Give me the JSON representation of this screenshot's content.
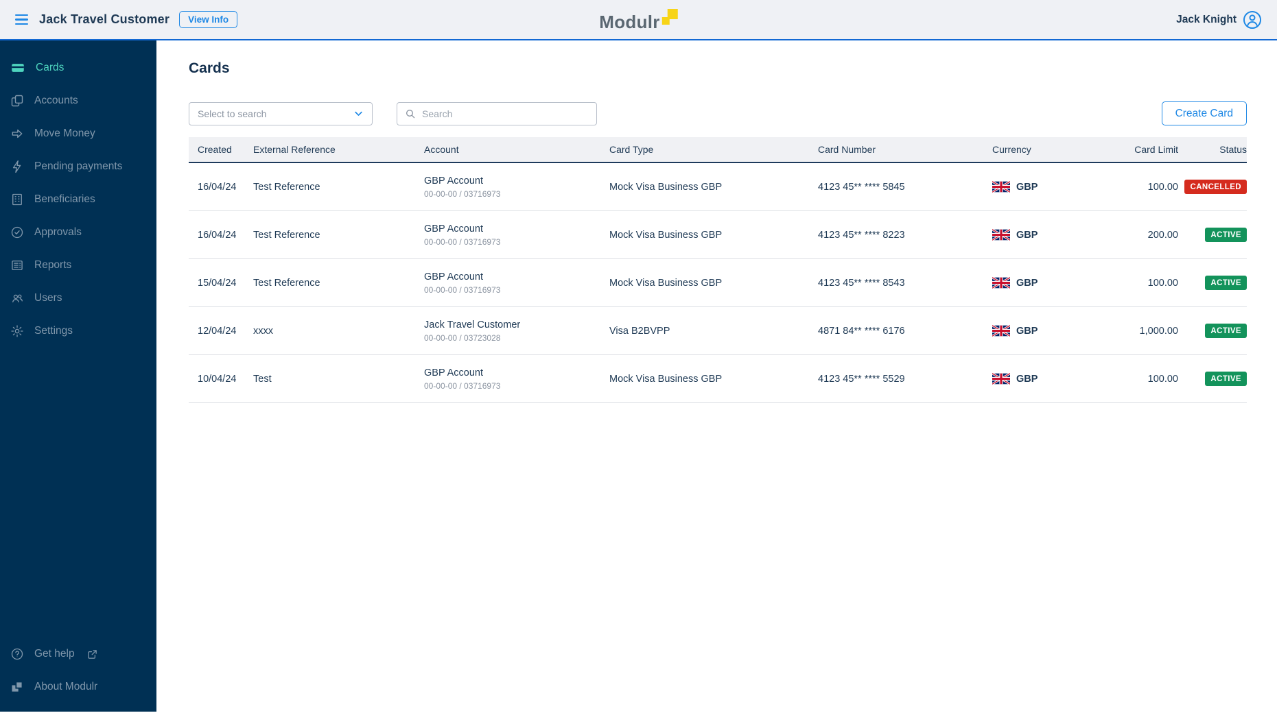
{
  "header": {
    "customer_name": "Jack Travel Customer",
    "view_info_label": "View Info",
    "logo_text": "Modulr",
    "user_name": "Jack Knight"
  },
  "sidebar": {
    "items": [
      {
        "label": "Cards",
        "icon": "card-icon",
        "active": true
      },
      {
        "label": "Accounts",
        "icon": "accounts-icon",
        "active": false
      },
      {
        "label": "Move Money",
        "icon": "arrow-right-icon",
        "active": false
      },
      {
        "label": "Pending payments",
        "icon": "lightning-icon",
        "active": false
      },
      {
        "label": "Beneficiaries",
        "icon": "building-grid-icon",
        "active": false
      },
      {
        "label": "Approvals",
        "icon": "check-circle-icon",
        "active": false
      },
      {
        "label": "Reports",
        "icon": "report-icon",
        "active": false
      },
      {
        "label": "Users",
        "icon": "users-icon",
        "active": false
      },
      {
        "label": "Settings",
        "icon": "gear-icon",
        "active": false
      }
    ],
    "footer_items": [
      {
        "label": "Get help",
        "icon": "help-icon",
        "external": true
      },
      {
        "label": "About Modulr",
        "icon": "modulr-squares-icon",
        "external": false
      }
    ]
  },
  "main": {
    "title": "Cards",
    "filter_placeholder": "Select to search",
    "search_placeholder": "Search",
    "create_button_label": "Create Card",
    "table": {
      "columns": [
        "Created",
        "External Reference",
        "Account",
        "Card Type",
        "Card Number",
        "Currency",
        "Card Limit",
        "Status"
      ],
      "rows": [
        {
          "created": "16/04/24",
          "external_reference": "Test Reference",
          "account_name": "GBP Account",
          "account_detail": "00-00-00 / 03716973",
          "card_type": "Mock Visa Business GBP",
          "card_number": "4123 45** **** 5845",
          "currency": "GBP",
          "card_limit": "100.00",
          "status": "CANCELLED"
        },
        {
          "created": "16/04/24",
          "external_reference": "Test Reference",
          "account_name": "GBP Account",
          "account_detail": "00-00-00 / 03716973",
          "card_type": "Mock Visa Business GBP",
          "card_number": "4123 45** **** 8223",
          "currency": "GBP",
          "card_limit": "200.00",
          "status": "ACTIVE"
        },
        {
          "created": "15/04/24",
          "external_reference": "Test Reference",
          "account_name": "GBP Account",
          "account_detail": "00-00-00 / 03716973",
          "card_type": "Mock Visa Business GBP",
          "card_number": "4123 45** **** 8543",
          "currency": "GBP",
          "card_limit": "100.00",
          "status": "ACTIVE"
        },
        {
          "created": "12/04/24",
          "external_reference": "xxxx",
          "account_name": "Jack Travel Customer",
          "account_detail": "00-00-00 / 03723028",
          "card_type": "Visa B2BVPP",
          "card_number": "4871 84** **** 6176",
          "currency": "GBP",
          "card_limit": "1,000.00",
          "status": "ACTIVE"
        },
        {
          "created": "10/04/24",
          "external_reference": "Test",
          "account_name": "GBP Account",
          "account_detail": "00-00-00 / 03716973",
          "card_type": "Mock Visa Business GBP",
          "card_number": "4123 45** **** 5529",
          "currency": "GBP",
          "card_limit": "100.00",
          "status": "ACTIVE"
        }
      ]
    }
  },
  "colors": {
    "accent_blue": "#1e88e5",
    "header_border_blue": "#1268d3",
    "sidebar_navy": "#003054",
    "active_teal": "#4ed4be",
    "badge_red": "#d52b1e",
    "badge_green": "#13935b",
    "logo_yellow": "#f7d417",
    "header_bg": "#eff1f5"
  }
}
